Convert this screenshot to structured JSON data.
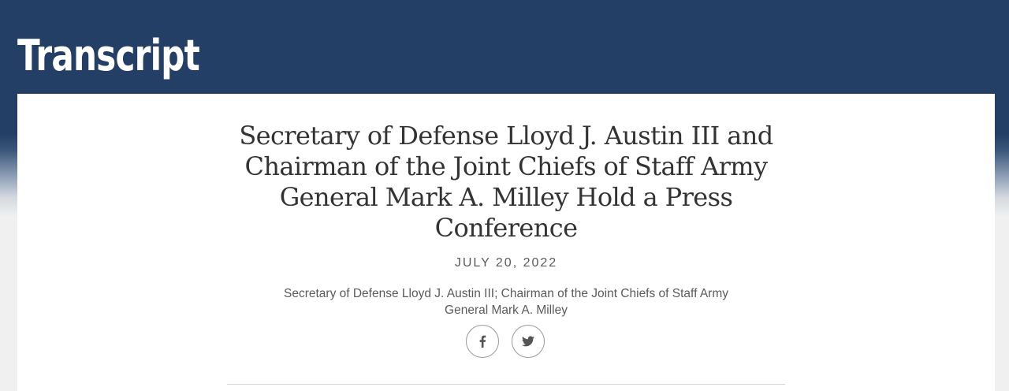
{
  "header": {
    "title": "Transcript"
  },
  "article": {
    "title": "Secretary of Defense Lloyd J. Austin III and Chairman of the Joint Chiefs of Staff Army General Mark A. Milley Hold a Press Conference",
    "date": "JULY 20, 2022",
    "participants": "Secretary of Defense Lloyd J. Austin III; Chairman of the Joint Chiefs of Staff Army General Mark A. Milley"
  },
  "share": {
    "icons": [
      "facebook-icon",
      "twitter-icon"
    ]
  },
  "colors": {
    "header_background": "#243f66",
    "card_background": "#ffffff",
    "title_text": "#333333",
    "meta_text": "#5a5a5a"
  }
}
